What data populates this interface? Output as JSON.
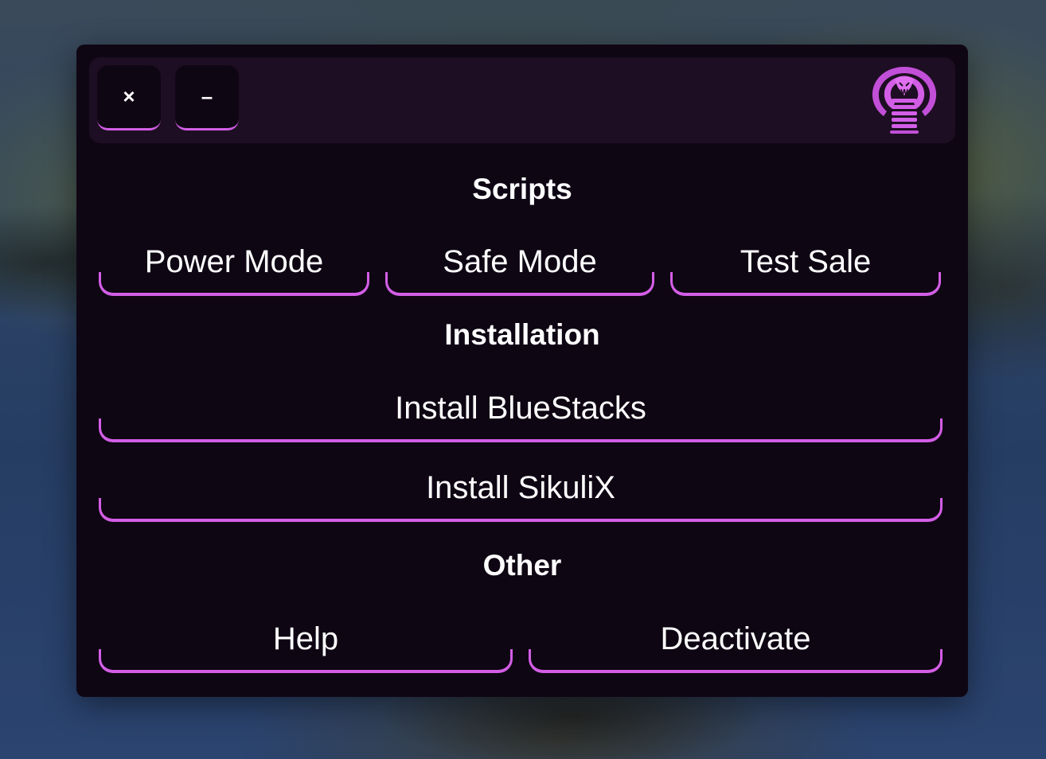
{
  "window": {
    "close_label": "×",
    "minimize_label": "–",
    "logo_icon": "cobra-logo-icon"
  },
  "colors": {
    "accent": "#d35ee6",
    "window_bg": "#0f0614",
    "titlebar_bg": "#1e0e23",
    "text": "#ffffff"
  },
  "sections": {
    "scripts": {
      "title": "Scripts",
      "buttons": [
        "Power Mode",
        "Safe Mode",
        "Test Sale"
      ]
    },
    "installation": {
      "title": "Installation",
      "buttons": [
        "Install BlueStacks",
        "Install SikuliX"
      ]
    },
    "other": {
      "title": "Other",
      "buttons": [
        "Help",
        "Deactivate"
      ]
    }
  }
}
